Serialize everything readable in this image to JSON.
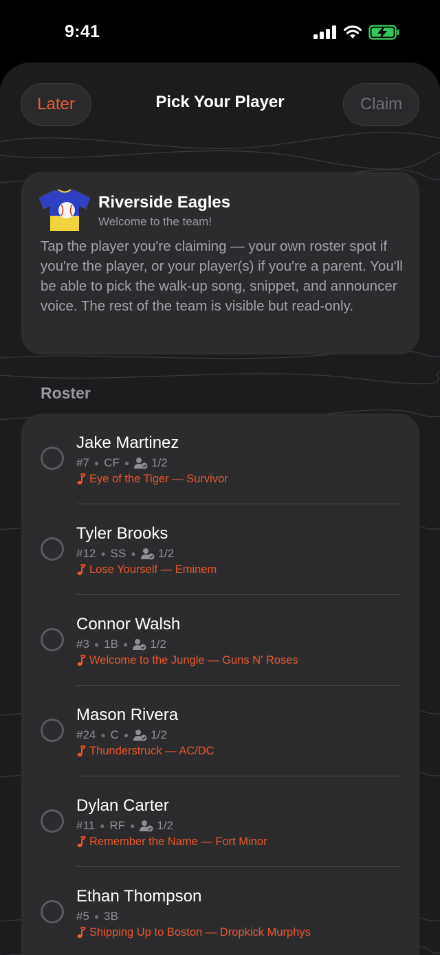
{
  "status": {
    "time": "9:41"
  },
  "nav": {
    "later": "Later",
    "title": "Pick Your Player",
    "claim": "Claim"
  },
  "team": {
    "name": "Riverside Eagles",
    "subtitle": "Welcome to the team!",
    "description": "Tap the player you're claiming — your own roster spot if you're the player, or your player(s) if you're a parent. You'll be able to pick the walk-up song, snippet, and announcer voice. The rest of the team is visible but read-only."
  },
  "roster": {
    "title": "Roster",
    "players": [
      {
        "name": "Jake Martinez",
        "number": "#7",
        "position": "CF",
        "claims": "1/2",
        "song": "Eye of the Tiger — Survivor"
      },
      {
        "name": "Tyler Brooks",
        "number": "#12",
        "position": "SS",
        "claims": "1/2",
        "song": "Lose Yourself — Eminem"
      },
      {
        "name": "Connor Walsh",
        "number": "#3",
        "position": "1B",
        "claims": "1/2",
        "song": "Welcome to the Jungle — Guns N' Roses"
      },
      {
        "name": "Mason Rivera",
        "number": "#24",
        "position": "C",
        "claims": "1/2",
        "song": "Thunderstruck — AC/DC"
      },
      {
        "name": "Dylan Carter",
        "number": "#11",
        "position": "RF",
        "claims": "1/2",
        "song": "Remember the Name — Fort Minor"
      },
      {
        "name": "Ethan Thompson",
        "number": "#5",
        "position": "3B",
        "song": "Shipping Up to Boston — Dropkick Murphys"
      }
    ]
  },
  "colors": {
    "accent": "#e8562c",
    "background": "#1c1c1e",
    "card": "#2c2c2e",
    "battery": "#34c759"
  },
  "icons": [
    "signal-icon",
    "wifi-icon",
    "battery-charging-icon",
    "team-jersey-icon",
    "person-check-icon",
    "music-note-icon"
  ]
}
